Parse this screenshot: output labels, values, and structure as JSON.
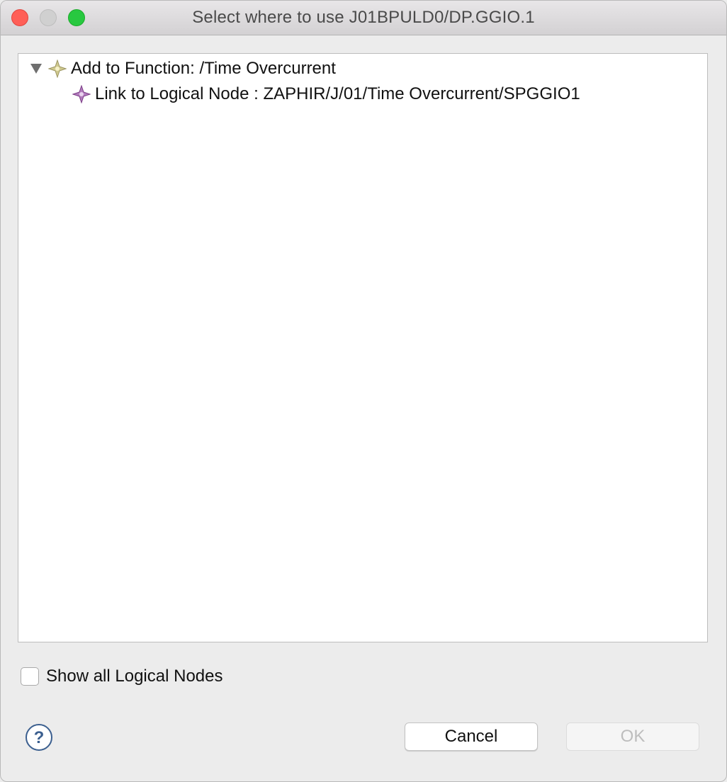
{
  "window": {
    "title": "Select where to use J01BPULD0/DP.GGIO.1"
  },
  "tree": {
    "items": [
      {
        "label": "Add to Function: /Time Overcurrent",
        "expanded": true,
        "icon": "function-sparkle-icon",
        "icon_color": "#b8b27a",
        "children": [
          {
            "label": "Link to Logical Node : ZAPHIR/J/01/Time Overcurrent/SPGGIO1",
            "icon": "logical-node-sparkle-icon",
            "icon_color": "#9b5ba4"
          }
        ]
      }
    ]
  },
  "options": {
    "show_all_label": "Show all Logical Nodes",
    "show_all_checked": false
  },
  "footer": {
    "help_icon": "question-mark-icon",
    "cancel_label": "Cancel",
    "ok_label": "OK",
    "ok_enabled": false
  },
  "colors": {
    "close": "#ff5f57",
    "minimize": "#d0d0d0",
    "maximize": "#28c840",
    "help": "#3b5f8f"
  }
}
